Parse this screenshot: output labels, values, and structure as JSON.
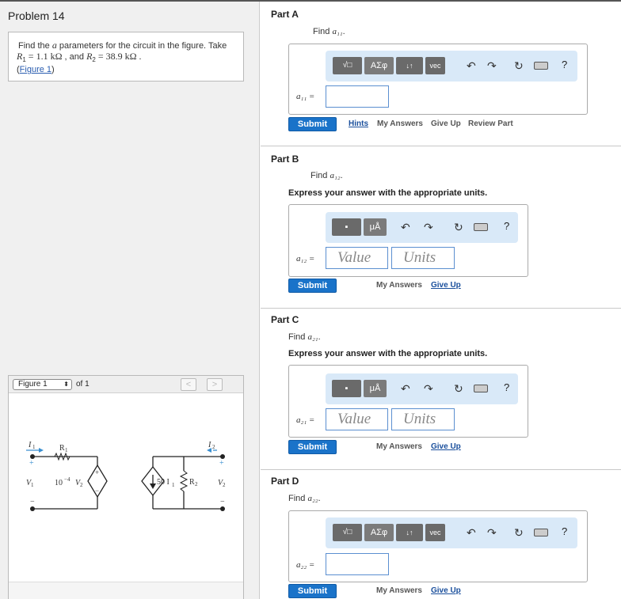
{
  "problem": {
    "title": "Problem 14",
    "text_prefix": "Find the ",
    "text_param": "a",
    "text_suffix": " parameters for the circuit in the figure. Take",
    "r1_label": "R",
    "r1_sub": "1",
    "r1_value": " = 1.1 kΩ",
    "and": " , and ",
    "r2_label": "R",
    "r2_sub": "2",
    "r2_value": " = 38.9 kΩ .",
    "figure_link": "Figure 1"
  },
  "figure": {
    "select_label": "Figure 1",
    "of_label": "of 1",
    "prev": "<",
    "next": ">",
    "labels": {
      "i1": "I",
      "i1_sub": "1",
      "r1": "R",
      "r1_sub": "1",
      "v1": "V",
      "v1_sub": "1",
      "gain": "10",
      "gain_exp": "−4",
      "v2_in": "V",
      "v2_in_sub": "2",
      "cccs": "50 I",
      "cccs_sub": "1",
      "r2": "R",
      "r2_sub": "2",
      "i2": "I",
      "i2_sub": "2",
      "v2": "V",
      "v2_sub": "2",
      "plus": "+",
      "minus": "−"
    }
  },
  "parts": [
    {
      "title": "Part A",
      "find_prefix": "Find ",
      "var": "a₁₁",
      "find_suffix": ".",
      "instruction": "",
      "label": "a₁₁ =",
      "submit": "Submit",
      "links": [
        "Hints",
        "My Answers",
        "Give Up",
        "Review Part"
      ],
      "toolbar": {
        "b1": "√□",
        "b2": "ΑΣφ",
        "b3": "↓↑",
        "b4": "vec"
      }
    },
    {
      "title": "Part B",
      "find_prefix": "Find ",
      "var": "a₁₂",
      "find_suffix": ".",
      "instruction": "Express your answer with the appropriate units.",
      "label": "a₁₂ =",
      "value_placeholder": "Value",
      "units_placeholder": "Units",
      "submit": "Submit",
      "links": [
        "My Answers",
        "Give Up"
      ],
      "toolbar": {
        "b1": "▪",
        "b2": "μÅ"
      }
    },
    {
      "title": "Part C",
      "find_prefix": "Find ",
      "var": "a₂₁",
      "find_suffix": ".",
      "instruction": "Express your answer with the appropriate units.",
      "label": "a₂₁ =",
      "value_placeholder": "Value",
      "units_placeholder": "Units",
      "submit": "Submit",
      "links": [
        "My Answers",
        "Give Up"
      ],
      "toolbar": {
        "b1": "▪",
        "b2": "μÅ"
      }
    },
    {
      "title": "Part D",
      "find_prefix": "Find ",
      "var": "a₂₂",
      "find_suffix": ".",
      "instruction": "",
      "label": "a₂₂ =",
      "submit": "Submit",
      "links": [
        "My Answers",
        "Give Up"
      ],
      "toolbar": {
        "b1": "√□",
        "b2": "ΑΣφ",
        "b3": "↓↑",
        "b4": "vec"
      }
    }
  ],
  "toolbar_icons": {
    "undo": "↶",
    "redo": "↷",
    "reset": "↻",
    "keyboard": "keyboard-icon",
    "help": "?"
  },
  "colors": {
    "submit": "#1a73c9",
    "toolbar_bg": "#d9e9f8",
    "link_blue": "#1a4f9c"
  }
}
